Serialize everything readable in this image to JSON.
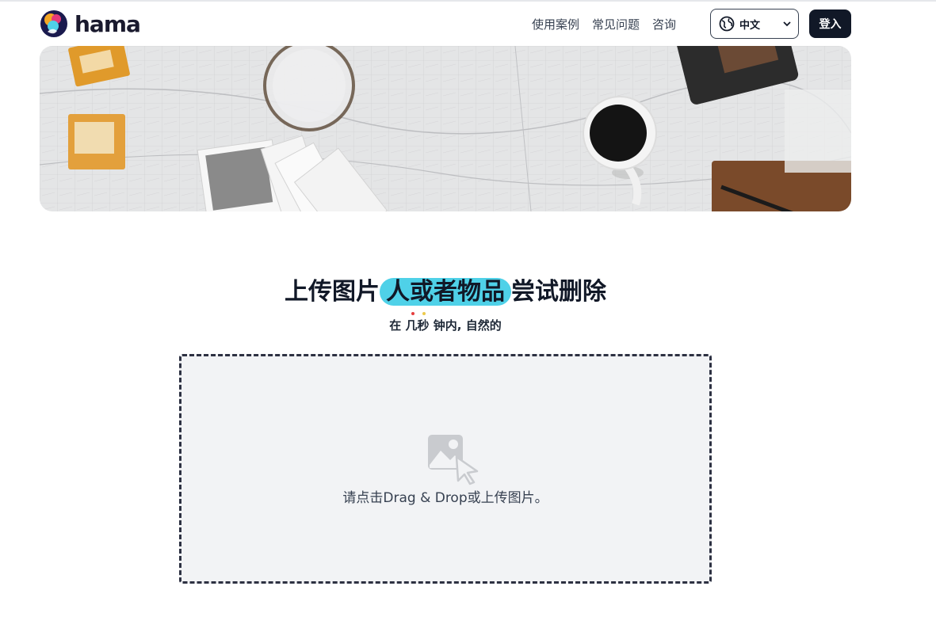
{
  "brand": {
    "name": "hama"
  },
  "nav": {
    "items": [
      {
        "label": "使用案例"
      },
      {
        "label": "常见问题"
      },
      {
        "label": "咨询"
      }
    ]
  },
  "language": {
    "selected": "中文",
    "icon": "globe-icon"
  },
  "auth": {
    "login_label": "登入"
  },
  "hero": {
    "title_prefix": "上传图片",
    "title_highlight": "人或者物品",
    "title_suffix": "尝试删除",
    "subtitle_a": "在",
    "subtitle_b": "几",
    "subtitle_c": "秒",
    "subtitle_d": "钟内, 自然的"
  },
  "upload": {
    "prompt": "请点击Drag & Drop或上传图片。",
    "icon": "image-upload-icon"
  },
  "colors": {
    "accent": "#4fd1e8",
    "dark": "#111827",
    "dot_red": "#e53e3e",
    "dot_yellow": "#ecc94b"
  }
}
